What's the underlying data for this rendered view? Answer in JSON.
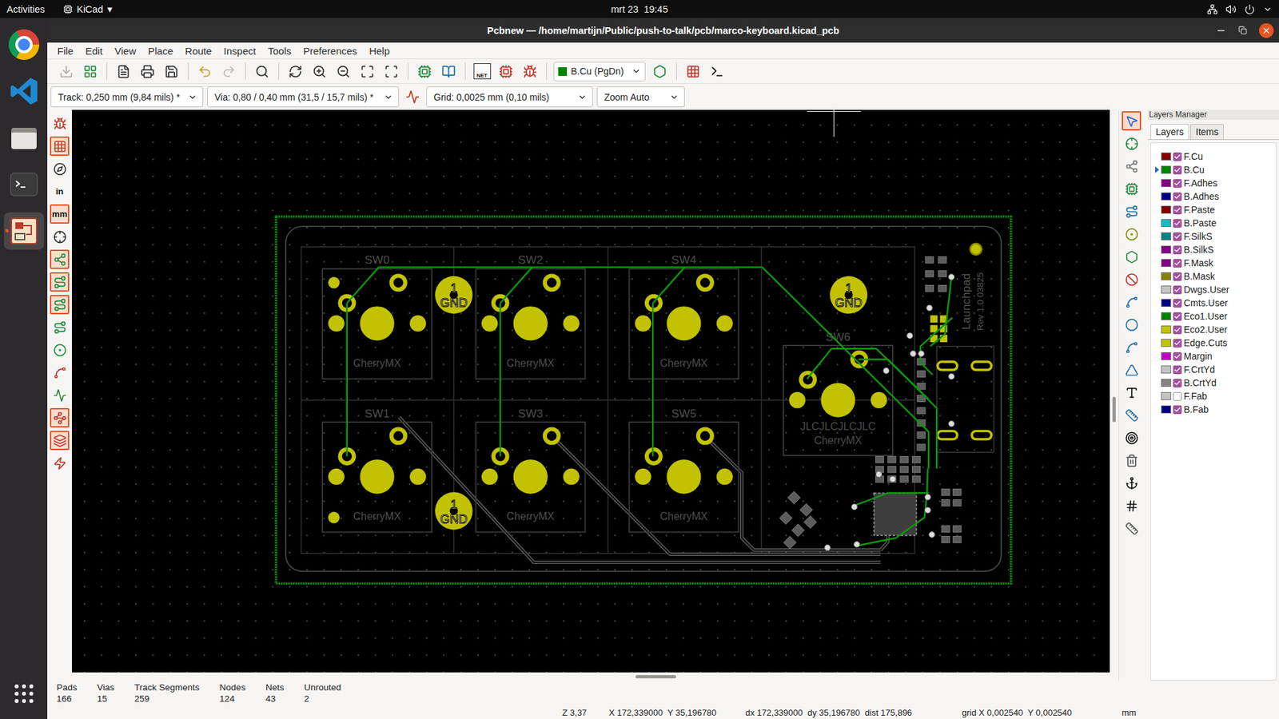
{
  "top_bar": {
    "activities": "Activities",
    "app_menu": "KiCad",
    "app_menu_arrow": "▾",
    "clock": "mrt 23  19:45"
  },
  "dock": [
    {
      "kind": "chrome",
      "selected": false
    },
    {
      "kind": "vscode",
      "selected": false
    },
    {
      "kind": "files",
      "selected": false
    },
    {
      "kind": "terminal",
      "selected": false
    },
    {
      "kind": "kicad",
      "selected": true
    }
  ],
  "window": {
    "title": "Pcbnew — /home/martijn/Public/push-to-talk/pcb/marco-keyboard.kicad_pcb"
  },
  "menu": [
    "File",
    "Edit",
    "View",
    "Place",
    "Route",
    "Inspect",
    "Tools",
    "Preferences",
    "Help"
  ],
  "toolbar": {
    "net_label": "NET",
    "layer_select": {
      "label": "B.Cu (PgDn)",
      "color": "#008400"
    }
  },
  "options_bar": {
    "track": "Track: 0,250 mm (9,84 mils) *",
    "via": "Via: 0,80 / 0,40 mm (31,5 / 15,7 mils) *",
    "grid": "Grid: 0,0025 mm (0,10 mils)",
    "zoom": "Zoom Auto"
  },
  "left_toolbar": [
    {
      "kind": "icon",
      "label": "",
      "selected": false
    },
    {
      "kind": "icon",
      "label": "",
      "selected": true
    },
    {
      "kind": "icon",
      "label": "",
      "selected": false
    },
    {
      "kind": "text",
      "label": "in",
      "selected": false
    },
    {
      "kind": "text",
      "label": "mm",
      "selected": true
    },
    {
      "kind": "icon",
      "label": "",
      "selected": false
    },
    {
      "kind": "icon",
      "label": "",
      "selected": true
    },
    {
      "kind": "icon",
      "label": "",
      "selected": true
    },
    {
      "kind": "icon",
      "label": "",
      "selected": true
    },
    {
      "kind": "icon",
      "label": "",
      "selected": false
    },
    {
      "kind": "icon",
      "label": "",
      "selected": false
    },
    {
      "kind": "icon",
      "label": "",
      "selected": false
    },
    {
      "kind": "icon",
      "label": "",
      "selected": false
    },
    {
      "kind": "icon",
      "label": "",
      "selected": true
    },
    {
      "kind": "icon",
      "label": "",
      "selected": true
    },
    {
      "kind": "icon",
      "label": "",
      "selected": false
    }
  ],
  "right_toolbar": [
    {
      "selected": true
    },
    {
      "selected": false
    },
    {
      "selected": false
    },
    {
      "selected": false
    },
    {
      "selected": false
    },
    {
      "selected": false
    },
    {
      "selected": false
    },
    {
      "selected": false
    },
    {
      "selected": false
    },
    {
      "selected": false
    },
    {
      "selected": false
    },
    {
      "selected": false
    },
    {
      "selected": false
    },
    {
      "selected": false
    },
    {
      "selected": false
    },
    {
      "selected": false
    },
    {
      "selected": false
    },
    {
      "selected": false
    },
    {
      "selected": false
    }
  ],
  "canvas": {
    "switches": [
      {
        "ref": "SW0",
        "value": "CherryMX"
      },
      {
        "ref": "SW2",
        "value": "CherryMX"
      },
      {
        "ref": "SW4",
        "value": "CherryMX"
      },
      {
        "ref": "SW1",
        "value": "CherryMX"
      },
      {
        "ref": "SW3",
        "value": "CherryMX"
      },
      {
        "ref": "SW5",
        "value": "CherryMX"
      },
      {
        "ref": "SW6",
        "value": "CherryMX"
      }
    ],
    "gnd_pads": [
      {
        "number": "1",
        "net": "GND"
      },
      {
        "number": "1",
        "net": "GND"
      },
      {
        "number": "1",
        "net": "GND"
      }
    ],
    "sw6_text": "JLCJLCJLCJLC",
    "board_text": [
      "Launchpad",
      "Rev 1.0 03825"
    ]
  },
  "layers_manager": {
    "title": "Layers Manager",
    "tabs": [
      {
        "label": "Layers",
        "selected": true
      },
      {
        "label": "Items",
        "selected": false
      }
    ],
    "layers": [
      {
        "name": "F.Cu",
        "color": "#840000",
        "visible": true,
        "selected": false
      },
      {
        "name": "B.Cu",
        "color": "#008400",
        "visible": true,
        "selected": true
      },
      {
        "name": "F.Adhes",
        "color": "#840084",
        "visible": true,
        "selected": false
      },
      {
        "name": "B.Adhes",
        "color": "#000084",
        "visible": true,
        "selected": false
      },
      {
        "name": "F.Paste",
        "color": "#840000",
        "visible": true,
        "selected": false
      },
      {
        "name": "B.Paste",
        "color": "#00c2c2",
        "visible": true,
        "selected": false
      },
      {
        "name": "F.SilkS",
        "color": "#008484",
        "visible": true,
        "selected": false
      },
      {
        "name": "B.SilkS",
        "color": "#840084",
        "visible": true,
        "selected": false
      },
      {
        "name": "F.Mask",
        "color": "#840084",
        "visible": true,
        "selected": false
      },
      {
        "name": "B.Mask",
        "color": "#848400",
        "visible": true,
        "selected": false
      },
      {
        "name": "Dwgs.User",
        "color": "#c2c2c2",
        "visible": true,
        "selected": false
      },
      {
        "name": "Cmts.User",
        "color": "#000084",
        "visible": true,
        "selected": false
      },
      {
        "name": "Eco1.User",
        "color": "#008400",
        "visible": true,
        "selected": false
      },
      {
        "name": "Eco2.User",
        "color": "#c2c200",
        "visible": true,
        "selected": false
      },
      {
        "name": "Edge.Cuts",
        "color": "#c2c200",
        "visible": true,
        "selected": false
      },
      {
        "name": "Margin",
        "color": "#c200c2",
        "visible": true,
        "selected": false
      },
      {
        "name": "F.CrtYd",
        "color": "#c2c2c2",
        "visible": true,
        "selected": false
      },
      {
        "name": "B.CrtYd",
        "color": "#848484",
        "visible": true,
        "selected": false
      },
      {
        "name": "F.Fab",
        "color": "#c2c2c2",
        "visible": false,
        "selected": false
      },
      {
        "name": "B.Fab",
        "color": "#000084",
        "visible": true,
        "selected": false
      }
    ]
  },
  "status": [
    {
      "label": "Pads",
      "value": "166"
    },
    {
      "label": "Vias",
      "value": "15"
    },
    {
      "label": "Track Segments",
      "value": "259"
    },
    {
      "label": "Nodes",
      "value": "124"
    },
    {
      "label": "Nets",
      "value": "43"
    },
    {
      "label": "Unrouted",
      "value": "2"
    }
  ],
  "coords": [
    "Z 3,37",
    "X 172,339000  Y 35,196780",
    "dx 172,339000  dy 35,196780  dist 175,896",
    "grid X 0,002540  Y 0,002540",
    "mm"
  ]
}
